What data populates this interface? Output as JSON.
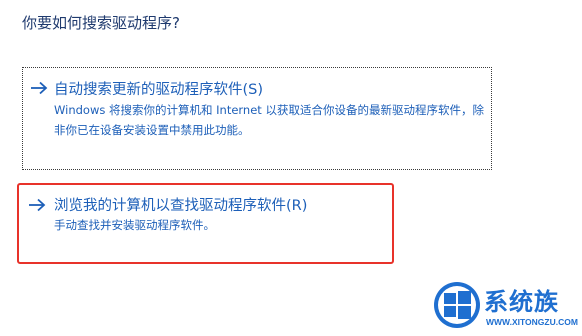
{
  "dialog": {
    "question": "你要如何搜索驱动程序?"
  },
  "options": [
    {
      "title": "自动搜索更新的驱动程序软件(S)",
      "description": "Windows 将搜索你的计算机和 Internet 以获取适合你设备的最新驱动程序软件，除非你已在设备安装设置中禁用此功能。",
      "icon": "arrow-right-icon"
    },
    {
      "title": "浏览我的计算机以查找驱动程序软件(R)",
      "description": "手动查找并安装驱动程序软件。",
      "icon": "arrow-right-icon"
    }
  ],
  "highlight_color": "#e8322a",
  "link_color": "#1d5fb8",
  "watermark": {
    "brand": "系统族",
    "url": "WWW.XITONGZU.COM",
    "icon": "windows-logo-icon"
  }
}
